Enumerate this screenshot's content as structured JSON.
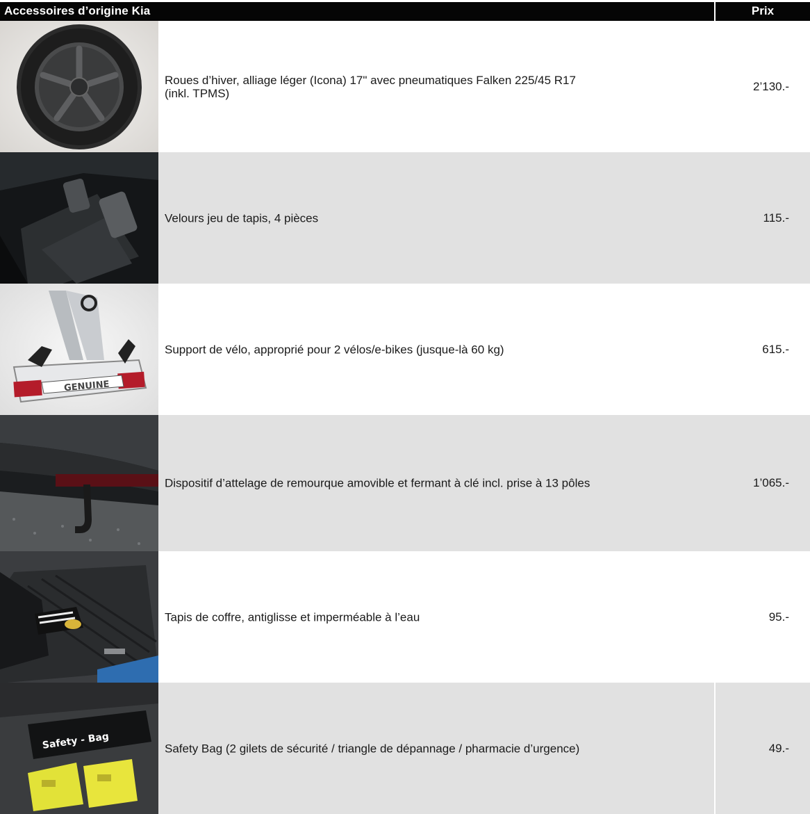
{
  "header": {
    "title": "Accessoires d’origine Kia",
    "price_label": "Prix"
  },
  "items": [
    {
      "image": "winter-wheel-image",
      "description": "Roues d’hiver, alliage léger (Icona) 17\" avec pneumatiques Falken 225/45 R17\n(inkl. TPMS)",
      "price": "2’130.-"
    },
    {
      "image": "floor-mats-image",
      "description": "Velours jeu de tapis, 4 pièces",
      "price": "115.-"
    },
    {
      "image": "bike-carrier-image",
      "image_text": "GENUINE",
      "description": "Support de vélo, approprié pour 2 vélos/e-bikes (jusque-là 60 kg)",
      "price": "615.-"
    },
    {
      "image": "tow-hitch-image",
      "description": "Dispositif d’attelage de remourque amovible et fermant à clé incl. prise à 13 pôles",
      "price": "1’065.-"
    },
    {
      "image": "trunk-mat-image",
      "description": "Tapis de coffre, antiglisse et imperméable à l’eau",
      "price": "95.-"
    },
    {
      "image": "safety-bag-image",
      "image_text": "Safety - Bag",
      "description": "Safety Bag (2 gilets de sécurité / triangle de dépannage / pharmacie d’urgence)",
      "price": "49.-"
    }
  ]
}
